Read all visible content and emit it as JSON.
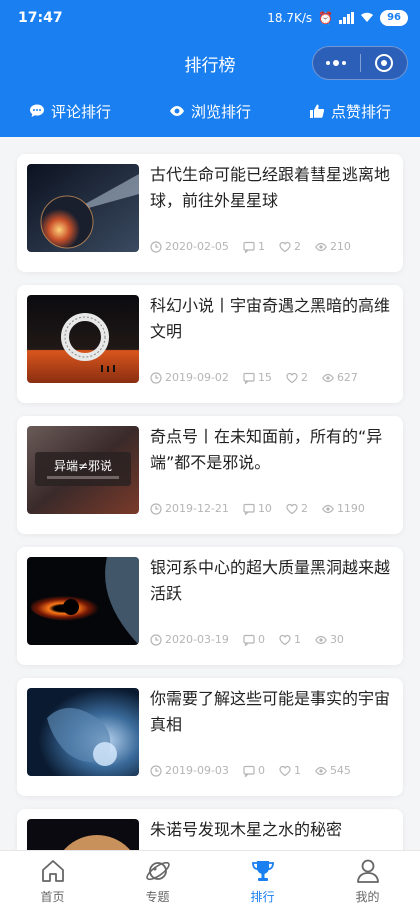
{
  "status": {
    "time": "17:47",
    "speed": "18.7K/s",
    "battery": "96"
  },
  "nav": {
    "title": "排行榜"
  },
  "tabs": [
    {
      "label": "评论排行",
      "icon": "comment-icon"
    },
    {
      "label": "浏览排行",
      "icon": "eye-icon"
    },
    {
      "label": "点赞排行",
      "icon": "thumbs-up-icon"
    }
  ],
  "articles": [
    {
      "title": "古代生命可能已经跟着彗星逃离地球，前往外星星球",
      "date": "2020-02-05",
      "comments": "1",
      "likes": "2",
      "views": "210"
    },
    {
      "title": "科幻小说丨宇宙奇遇之黑暗的高维文明",
      "date": "2019-09-02",
      "comments": "15",
      "likes": "2",
      "views": "627"
    },
    {
      "title": "奇点号丨在未知面前，所有的“异端”都不是邪说。",
      "date": "2019-12-21",
      "comments": "10",
      "likes": "2",
      "views": "1190",
      "thumb_text": "异端≠邪说"
    },
    {
      "title": "银河系中心的超大质量黑洞越来越活跃",
      "date": "2020-03-19",
      "comments": "0",
      "likes": "1",
      "views": "30"
    },
    {
      "title": "你需要了解这些可能是事实的宇宙真相",
      "date": "2019-09-03",
      "comments": "0",
      "likes": "1",
      "views": "545"
    },
    {
      "title": "朱诺号发现木星之水的秘密",
      "date": "",
      "comments": "",
      "likes": "",
      "views": ""
    }
  ],
  "tabbar": [
    {
      "label": "首页",
      "icon": "home-icon"
    },
    {
      "label": "专题",
      "icon": "planet-icon"
    },
    {
      "label": "排行",
      "icon": "trophy-icon",
      "active": true
    },
    {
      "label": "我的",
      "icon": "user-icon"
    }
  ],
  "colors": {
    "primary": "#1a7ff0",
    "meta": "#b5b5b5"
  }
}
